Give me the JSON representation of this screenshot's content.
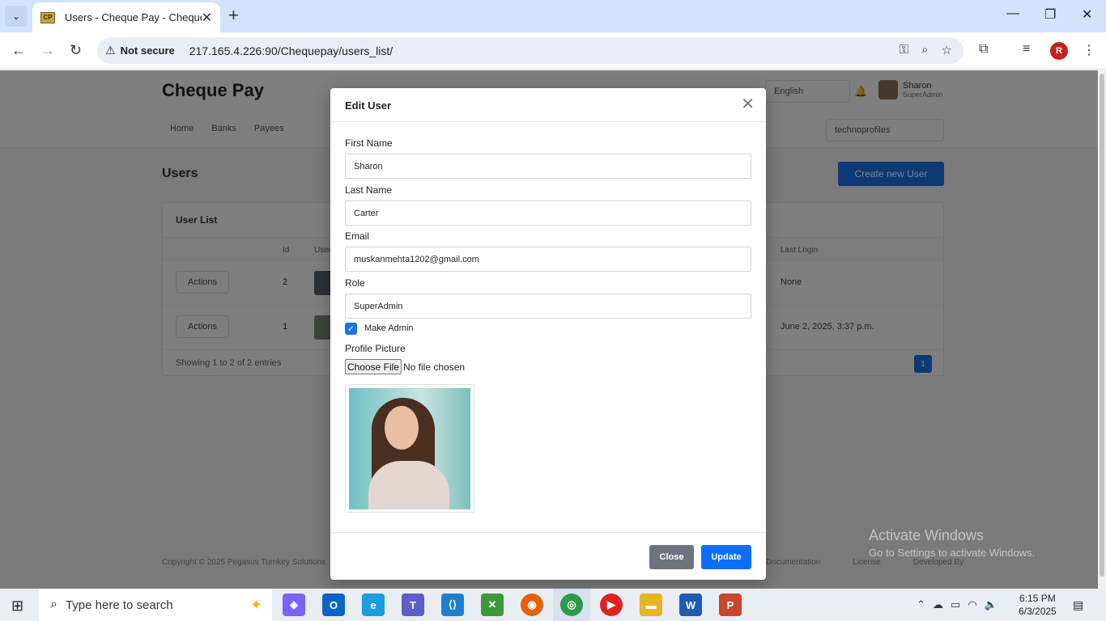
{
  "browser": {
    "tab_title": "Users - Cheque Pay - Cheque P",
    "not_secure": "Not secure",
    "url": "217.165.4.226:90/Chequepay/users_list/",
    "profile_initial": "R"
  },
  "page": {
    "logo": "Cheque Pay",
    "language": "English",
    "user_name": "Sharon",
    "user_role": "SuperAdmin",
    "menu": [
      "Home",
      "Banks",
      "Payees"
    ],
    "tenant": "technoprofiles",
    "title": "Users",
    "create_button": "Create new User",
    "card_title": "User List",
    "columns": {
      "id": "Id",
      "user": "User",
      "last_login": "Last Login"
    },
    "rows": [
      {
        "action": "Actions",
        "id": "2",
        "last_login": "None"
      },
      {
        "action": "Actions",
        "id": "1",
        "last_login": "June 2, 2025, 3:37 p.m."
      }
    ],
    "showing": "Showing 1 to 2 of 2 entries",
    "page_number": "1",
    "footer": "Copyright © 2025 Pegasus Turnkey Solutions",
    "footer_links": [
      "Documentation",
      "License",
      "Developed By"
    ]
  },
  "modal": {
    "title": "Edit User",
    "first_name_label": "First Name",
    "first_name_value": "Sharon",
    "last_name_label": "Last Name",
    "last_name_value": "Carter",
    "email_label": "Email",
    "email_value": "muskanmehta1202@gmail.com",
    "role_label": "Role",
    "role_value": "SuperAdmin",
    "make_admin_label": "Make Admin",
    "make_admin_checked": true,
    "profile_picture_label": "Profile Picture",
    "choose_file": "Choose File",
    "file_status": "No file chosen",
    "close_button": "Close",
    "update_button": "Update"
  },
  "watermark": {
    "line1": "Activate Windows",
    "line2": "Go to Settings to activate Windows."
  },
  "taskbar": {
    "search_placeholder": "Type here to search",
    "time": "6:15 PM",
    "date": "6/3/2025"
  },
  "colors": {
    "primary": "#0d6efd",
    "secondary": "#6c757d",
    "tabbar": "#d3e3fd"
  }
}
